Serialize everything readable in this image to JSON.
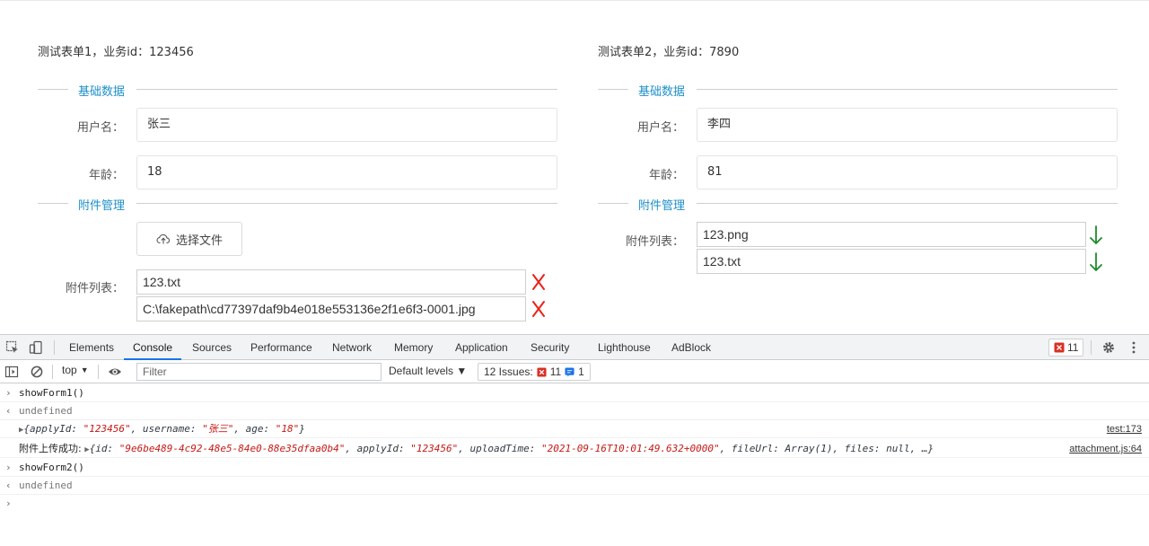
{
  "form1": {
    "title": "测试表单1，业务id：123456",
    "section_basic": "基础数据",
    "username_label": "用户名：",
    "username_value": "张三",
    "age_label": "年龄：",
    "age_value": "18",
    "section_attachments": "附件管理",
    "upload_button": "选择文件",
    "attachments_label": "附件列表：",
    "files": [
      "123.txt",
      "C:\\fakepath\\cd77397daf9b4e018e553136e2f1e6f3-0001.jpg"
    ],
    "file_action_color": "#e8231a"
  },
  "form2": {
    "title": "测试表单2，业务id：7890",
    "section_basic": "基础数据",
    "username_label": "用户名：",
    "username_value": "李四",
    "age_label": "年龄：",
    "age_value": "81",
    "section_attachments": "附件管理",
    "attachments_label": "附件列表：",
    "files": [
      "123.png",
      "123.txt"
    ],
    "file_action_color": "#1e8a2e"
  },
  "devtools": {
    "tabs": [
      "Elements",
      "Console",
      "Sources",
      "Performance",
      "Network",
      "Memory",
      "Application",
      "Security",
      "Lighthouse",
      "AdBlock"
    ],
    "active_tab": "Console",
    "error_count": "11",
    "context": "top",
    "filter_placeholder": "Filter",
    "levels": "Default levels ▼",
    "issues_label": "12 Issues:",
    "issues_errors": "11",
    "issues_info": "1",
    "accent_color": "#1a73e8",
    "error_color": "#d93025"
  },
  "console": {
    "line1_cmd": "showForm1()",
    "line2_result": "undefined",
    "line3": {
      "prefix": "{applyId: ",
      "applyId": "\"123456\"",
      "mid1": ", username: ",
      "username": "\"张三\"",
      "mid2": ", age: ",
      "age": "\"18\"",
      "suffix": "}",
      "source": "test:173"
    },
    "line4": {
      "label": "附件上传成功: ",
      "prefix": "{id: ",
      "id": "\"9e6be489-4c92-48e5-84e0-88e35dfaa0b4\"",
      "mid1": ", applyId: ",
      "applyId": "\"123456\"",
      "mid2": ", uploadTime: ",
      "uploadTime": "\"2021-09-16T10:01:49.632+0000\"",
      "mid3": ", fileUrl: Array(1), files: null, …}",
      "source": "attachment.js:64"
    },
    "line5_cmd": "showForm2()",
    "line6_result": "undefined"
  }
}
